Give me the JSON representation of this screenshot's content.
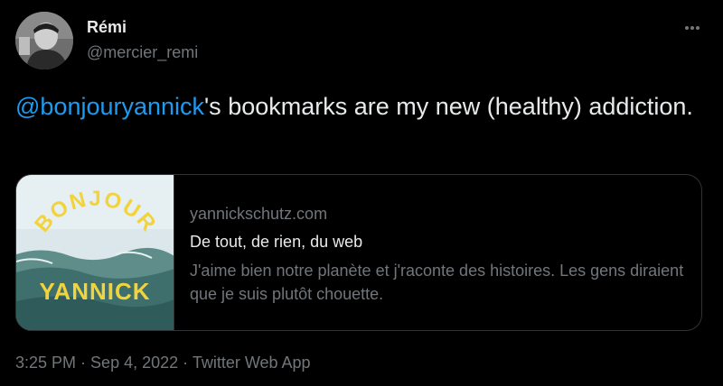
{
  "author": {
    "name": "Rémi",
    "handle": "@mercier_remi"
  },
  "tweet": {
    "mention": "@bonjouryannick",
    "text": "'s bookmarks are my new (healthy) addiction."
  },
  "card": {
    "image_text_top": "BONJOUR",
    "image_text_bottom": "YANNICK",
    "domain": "yannickschutz.com",
    "title": "De tout, de rien, du web",
    "description": "J'aime bien notre planète et j'raconte des histoires. Les gens diraient que je suis plutôt chouette."
  },
  "meta": {
    "time": "3:25 PM",
    "separator": " · ",
    "date": "Sep 4, 2022",
    "source": "Twitter Web App"
  },
  "colors": {
    "background": "#000000",
    "text": "#e7e9ea",
    "muted": "#71767b",
    "link": "#1d9bf0",
    "border": "#2f3336",
    "card_yellow": "#f2d33b"
  },
  "icons": {
    "more": "more-horizontal-icon"
  }
}
